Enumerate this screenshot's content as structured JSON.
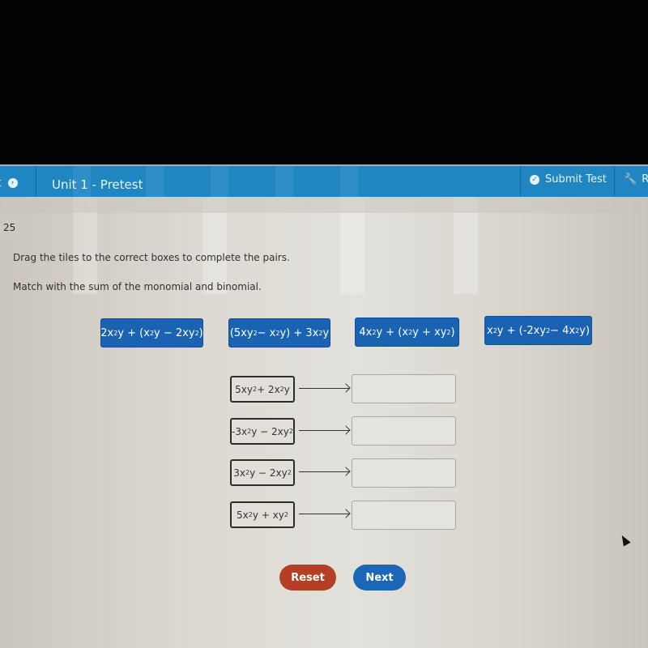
{
  "header": {
    "prev_label": "t",
    "title": "Unit 1 - Pretest",
    "submit_label": "Submit Test",
    "tools_label": "R"
  },
  "question": {
    "number": "25",
    "instruction": "Drag the tiles to the correct boxes to complete the pairs.",
    "prompt": "Match with the sum of the monomial and binomial."
  },
  "tiles": [
    {
      "html": "2x<sup>2</sup>y + (x<sup>2</sup>y − 2xy<sup>2</sup>)",
      "text": "2x²y + (x²y − 2xy²)"
    },
    {
      "html": "(5xy<sup>2</sup> − x<sup>2</sup>y) + 3x<sup>2</sup>y",
      "text": "(5xy² − x²y) + 3x²y"
    },
    {
      "html": "4x<sup>2</sup>y + (x<sup>2</sup>y + xy<sup>2</sup>)",
      "text": "4x²y + (x²y + xy²)"
    },
    {
      "html": "x<sup>2</sup>y + (-2xy<sup>2</sup> − 4x<sup>2</sup>y)",
      "text": "x²y + (-2xy² − 4x²y)"
    }
  ],
  "pairs": [
    {
      "html": "5xy<sup>2</sup> + 2x<sup>2</sup>y",
      "text": "5xy² + 2x²y",
      "answer": ""
    },
    {
      "html": "-3x<sup>2</sup>y − 2xy<sup>2</sup>",
      "text": "-3x²y − 2xy²",
      "answer": ""
    },
    {
      "html": "3x<sup>2</sup>y − 2xy<sup>2</sup>",
      "text": "3x²y − 2xy²",
      "answer": ""
    },
    {
      "html": "5x<sup>2</sup>y + xy<sup>2</sup>",
      "text": "5x²y + xy²",
      "answer": ""
    }
  ],
  "buttons": {
    "reset": "Reset",
    "next": "Next"
  },
  "colors": {
    "header_blue": "#1f86c1",
    "tile_blue": "#1a63b3",
    "reset_red": "#b53f22",
    "next_blue": "#1a67b8"
  }
}
